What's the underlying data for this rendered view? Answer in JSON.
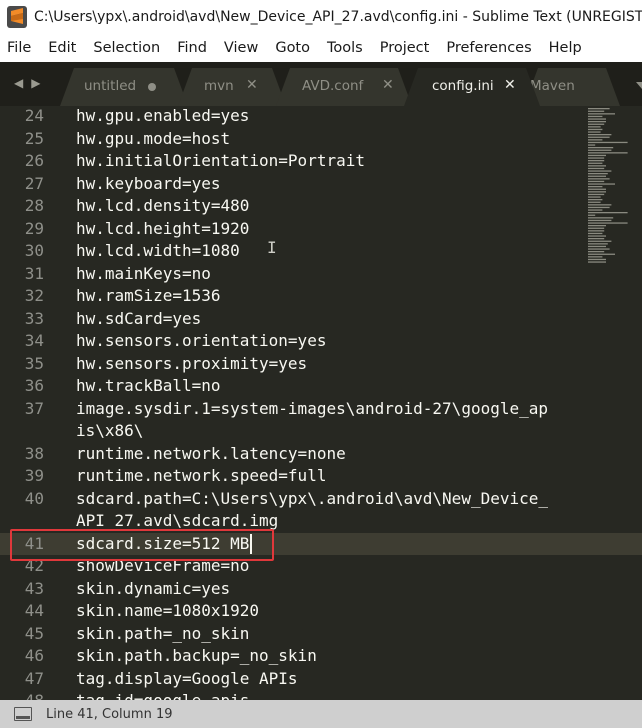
{
  "window": {
    "title": "C:\\Users\\ypx\\.android\\avd\\New_Device_API_27.avd\\config.ini - Sublime Text (UNREGISTERED)"
  },
  "menu": [
    "File",
    "Edit",
    "Selection",
    "Find",
    "View",
    "Goto",
    "Tools",
    "Project",
    "Preferences",
    "Help"
  ],
  "tabs": [
    {
      "label": "untitled",
      "state": "dirty"
    },
    {
      "label": "mvn",
      "state": "clean"
    },
    {
      "label": "AVD.conf",
      "state": "clean"
    },
    {
      "label": "config.ini",
      "state": "active"
    },
    {
      "label": "Maven",
      "state": "clean"
    }
  ],
  "editor": {
    "cursor_line": 41,
    "highlighted_line": 41,
    "lines": [
      {
        "n": "24",
        "text": "hw.gpu.enabled=yes"
      },
      {
        "n": "25",
        "text": "hw.gpu.mode=host"
      },
      {
        "n": "26",
        "text": "hw.initialOrientation=Portrait"
      },
      {
        "n": "27",
        "text": "hw.keyboard=yes"
      },
      {
        "n": "28",
        "text": "hw.lcd.density=480"
      },
      {
        "n": "29",
        "text": "hw.lcd.height=1920"
      },
      {
        "n": "30",
        "text": "hw.lcd.width=1080"
      },
      {
        "n": "31",
        "text": "hw.mainKeys=no"
      },
      {
        "n": "32",
        "text": "hw.ramSize=1536"
      },
      {
        "n": "33",
        "text": "hw.sdCard=yes"
      },
      {
        "n": "34",
        "text": "hw.sensors.orientation=yes"
      },
      {
        "n": "35",
        "text": "hw.sensors.proximity=yes"
      },
      {
        "n": "36",
        "text": "hw.trackBall=no"
      },
      {
        "n": "37",
        "text": "image.sysdir.1=system-images\\android-27\\google_ap"
      },
      {
        "n": "",
        "text": "is\\x86\\"
      },
      {
        "n": "38",
        "text": "runtime.network.latency=none"
      },
      {
        "n": "39",
        "text": "runtime.network.speed=full"
      },
      {
        "n": "40",
        "text": "sdcard.path=C:\\Users\\ypx\\.android\\avd\\New_Device_"
      },
      {
        "n": "",
        "text": "API_27.avd\\sdcard.img"
      },
      {
        "n": "41",
        "text": "sdcard.size=512 MB"
      },
      {
        "n": "42",
        "text": "showDeviceFrame=no"
      },
      {
        "n": "43",
        "text": "skin.dynamic=yes"
      },
      {
        "n": "44",
        "text": "skin.name=1080x1920"
      },
      {
        "n": "45",
        "text": "skin.path=_no_skin"
      },
      {
        "n": "46",
        "text": "skin.path.backup=_no_skin"
      },
      {
        "n": "47",
        "text": "tag.display=Google APIs"
      },
      {
        "n": "48",
        "text": "tag.id=google_apis"
      }
    ]
  },
  "status": {
    "position": "Line 41, Column 19"
  },
  "colors": {
    "editor_bg": "#272822",
    "tab_active_bg": "#272822",
    "tab_inactive_bg": "#34352d",
    "annotation": "#e0383b",
    "app_icon": "#f28b28"
  }
}
